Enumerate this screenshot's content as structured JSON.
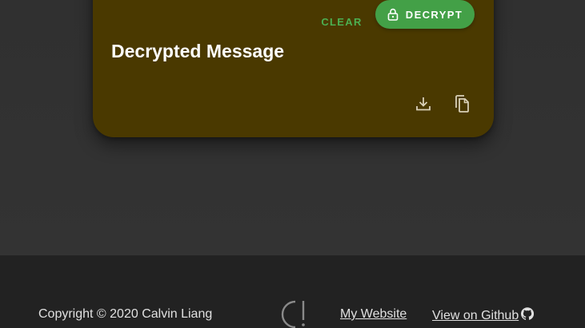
{
  "card": {
    "clear_label": "CLEAR",
    "decrypt_label": "DECRYPT",
    "title": "Decrypted Message"
  },
  "icons": {
    "lock": "lock-icon",
    "download": "download-icon",
    "copy": "copy-icon",
    "logo": "logo-icon",
    "github": "github-icon"
  },
  "footer": {
    "copyright": "Copyright © 2020 Calvin Liang",
    "website_label": "My Website",
    "github_label": "View on Github"
  },
  "colors": {
    "card_background": "#4a3900",
    "accent_green": "#43a047",
    "clear_text": "#4caf50",
    "page_background": "#313131",
    "footer_background": "#222222"
  }
}
